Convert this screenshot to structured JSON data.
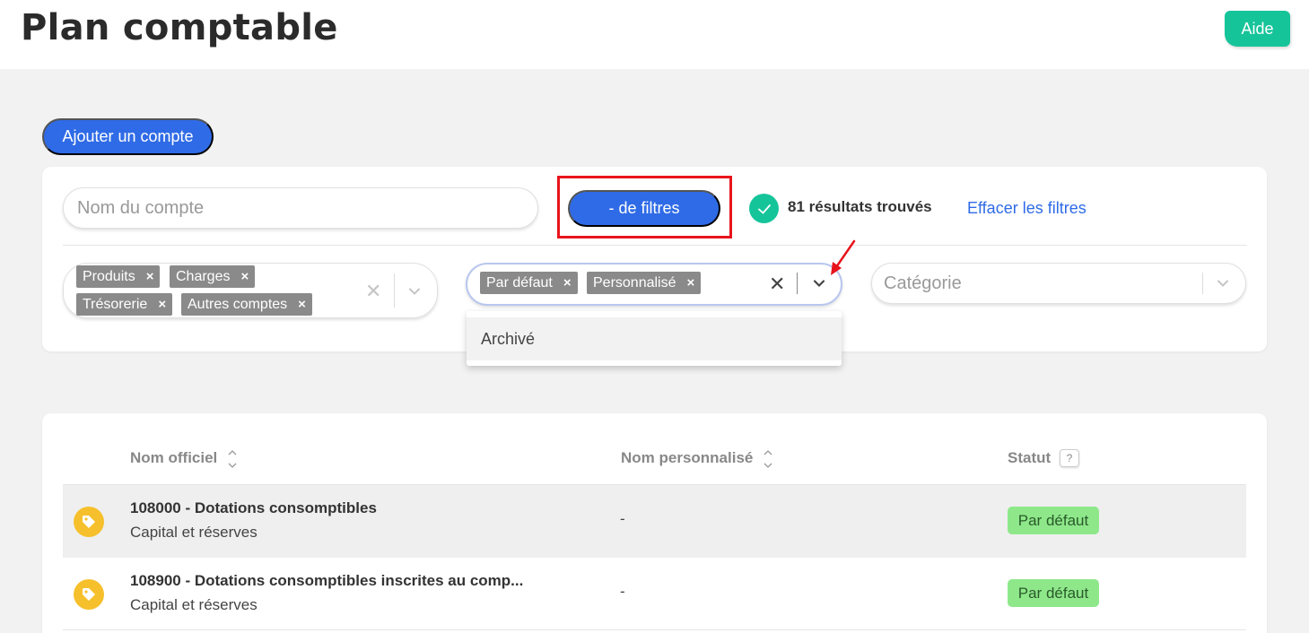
{
  "header": {
    "title": "Plan comptable",
    "help_label": "Aide"
  },
  "toolbar": {
    "add_label": "Ajouter un compte"
  },
  "filters": {
    "search_placeholder": "Nom du compte",
    "less_filters_label": "- de filtres",
    "results_label": "81 résultats trouvés",
    "clear_label": "Effacer les filtres",
    "type_tags": [
      "Produits",
      "Charges",
      "Trésorerie",
      "Autres comptes"
    ],
    "status_tags": [
      "Par défaut",
      "Personnalisé"
    ],
    "category_placeholder": "Catégorie",
    "dropdown_options": [
      "Archivé"
    ],
    "tag_remove_glyph": "×",
    "clear_glyph": "✕"
  },
  "table": {
    "columns": [
      "Nom officiel",
      "Nom personnalisé",
      "Statut"
    ],
    "help_glyph": "?",
    "rows": [
      {
        "name": "108000 - Dotations consomptibles",
        "category": "Capital et réserves",
        "custom_name": "-",
        "status": "Par défaut"
      },
      {
        "name": "108900 - Dotations consomptibles inscrites au comp...",
        "category": "Capital et réserves",
        "custom_name": "-",
        "status": "Par défaut"
      }
    ]
  },
  "colors": {
    "primary": "#2f6be6",
    "success": "#16c49a",
    "highlight": "#e8141c",
    "status_default": "#8ee88a",
    "tag_icon": "#f6c02c"
  }
}
